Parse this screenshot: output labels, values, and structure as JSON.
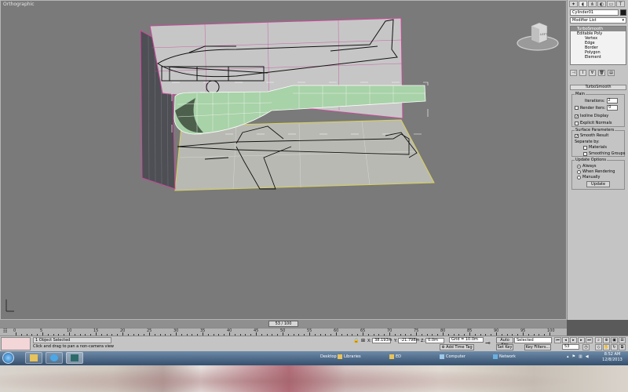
{
  "viewport": {
    "label": "Orthographic",
    "viewcube_label": "LEFT"
  },
  "command_panel": {
    "object_name": "Cylinder01",
    "modifier_list": "Modifier List",
    "stack": [
      {
        "label": "TurboSmooth",
        "selected": true
      },
      {
        "label": "Editable Poly",
        "selected": false
      }
    ],
    "sub_objects": [
      "Vertex",
      "Edge",
      "Border",
      "Polygon",
      "Element"
    ],
    "rollout_title": "TurboSmooth",
    "main": {
      "title": "Main",
      "iterations_label": "Iterations:",
      "iterations_value": "2",
      "render_iters_label": "Render Iters:",
      "render_iters_value": "0",
      "isoline_label": "Isoline Display",
      "explicit_normals_label": "Explicit Normals"
    },
    "surface": {
      "title": "Surface Parameters",
      "smooth_result_label": "Smooth Result",
      "separate_by_label": "Separate by:",
      "materials_label": "Materials",
      "smoothing_groups_label": "Smoothing Groups"
    },
    "update": {
      "title": "Update Options",
      "always_label": "Always",
      "when_rendering_label": "When Rendering",
      "manually_label": "Manually",
      "update_button": "Update"
    }
  },
  "timeline": {
    "slider_label": "53 / 100",
    "ticks": [
      "0",
      "5",
      "10",
      "15",
      "20",
      "25",
      "30",
      "35",
      "40",
      "45",
      "50",
      "55",
      "60",
      "65",
      "70",
      "75",
      "80",
      "85",
      "90",
      "95",
      "100"
    ]
  },
  "status": {
    "objects_selected": "1 Object Selected",
    "prompt": "Click and drag to pan a non-camera view",
    "x_label": "X:",
    "x_value": "38.193m",
    "y_label": "Y:",
    "y_value": "-21.798m",
    "z_label": "Z:",
    "z_value": "0.0m",
    "grid": "Grid = 10.0m",
    "add_time_tag": "Add Time Tag",
    "auto_key": "Auto Key",
    "selected_dropdown": "Selected",
    "set_key": "Set Key",
    "key_filters": "Key Filters...",
    "frame_value": "53"
  },
  "taskbar": {
    "desktop_label": "Desktop",
    "items": [
      "Libraries",
      "ED",
      "Computer",
      "Network"
    ],
    "time": "8:52 AM",
    "date": "12/8/2013"
  },
  "colors": {
    "viewport_bg": "#7a7a7a",
    "selection_mesh": "#a8d2a8",
    "grid_magenta": "#c84a9a",
    "panel_bg": "#c4c4c4"
  }
}
